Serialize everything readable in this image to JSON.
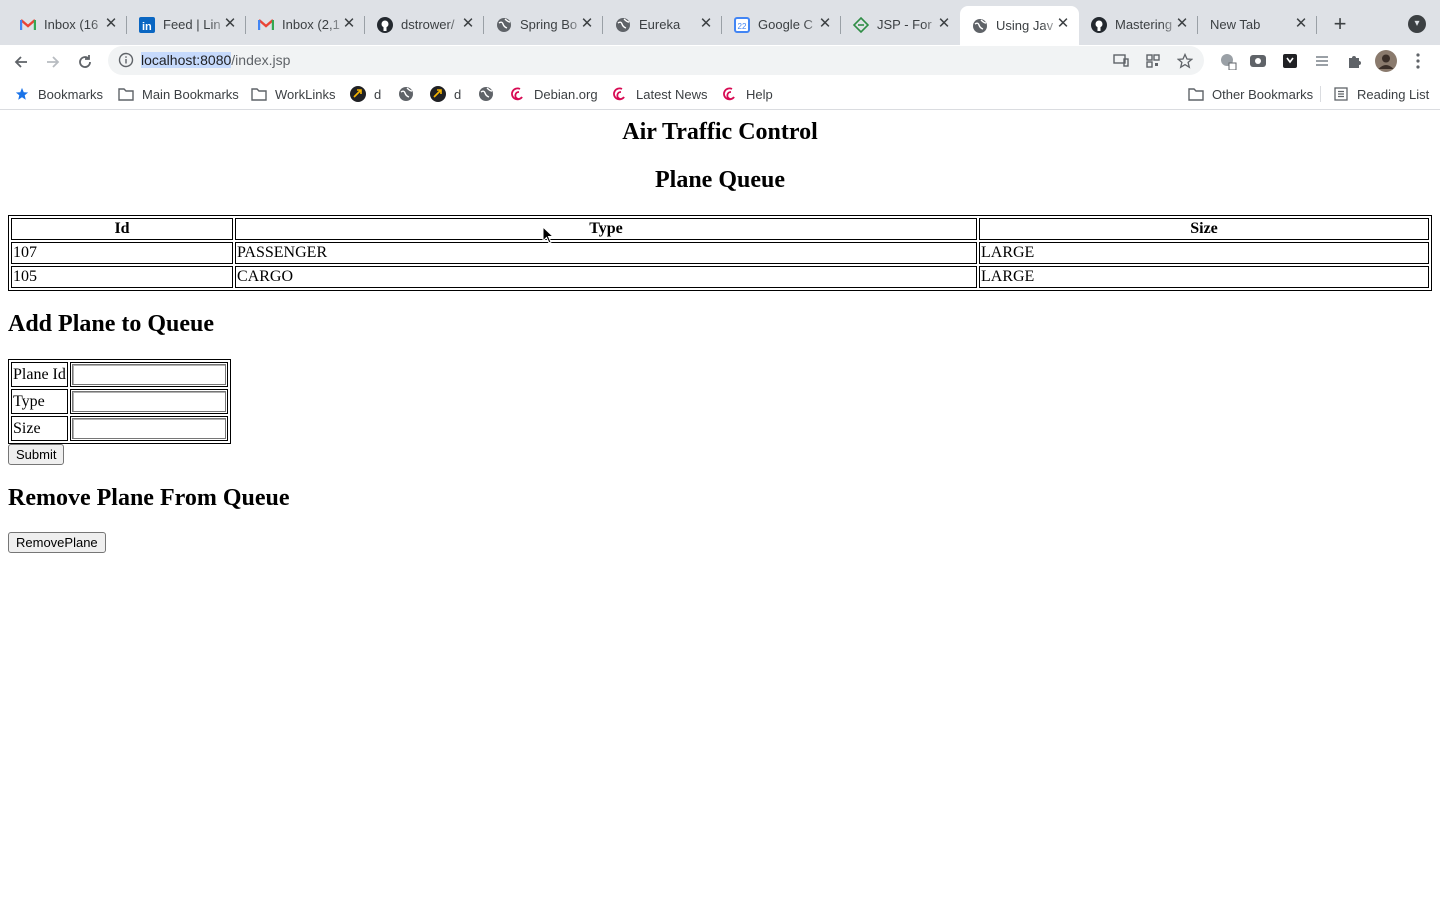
{
  "browser": {
    "tabs": [
      {
        "title": "Inbox (16",
        "icon": "gmail-icon"
      },
      {
        "title": "Feed | Lin",
        "icon": "linkedin-icon"
      },
      {
        "title": "Inbox (2,1",
        "icon": "gmail-icon"
      },
      {
        "title": "dstrower/",
        "icon": "github-icon"
      },
      {
        "title": "Spring Bo",
        "icon": "globe-icon"
      },
      {
        "title": "Eureka",
        "icon": "globe-icon"
      },
      {
        "title": "Google C",
        "icon": "google-calendar-icon"
      },
      {
        "title": "JSP - For",
        "icon": "diamond-icon"
      },
      {
        "title": "Using Jav",
        "icon": "globe-icon"
      },
      {
        "title": "Mastering",
        "icon": "github-icon"
      },
      {
        "title": "New Tab",
        "icon": ""
      }
    ],
    "active_tab_index": 8,
    "url_host": "localhost:8080",
    "url_path": "/index.jsp",
    "bookmarks": [
      {
        "label": "Bookmarks",
        "icon": "star-icon"
      },
      {
        "label": "Main Bookmarks",
        "icon": "folder-icon"
      },
      {
        "label": "WorkLinks",
        "icon": "folder-icon"
      },
      {
        "label": "d",
        "icon": "site-icon"
      },
      {
        "label": "",
        "icon": "globe-icon"
      },
      {
        "label": "d",
        "icon": "site-icon"
      },
      {
        "label": "",
        "icon": "globe-icon"
      },
      {
        "label": "Debian.org",
        "icon": "debian-icon"
      },
      {
        "label": "Latest News",
        "icon": "debian-icon"
      },
      {
        "label": "Help",
        "icon": "debian-icon"
      }
    ],
    "other_bookmarks": "Other Bookmarks",
    "reading_list": "Reading List"
  },
  "page": {
    "title": "Air Traffic Control",
    "queue_heading": "Plane Queue",
    "queue_columns": [
      "Id",
      "Type",
      "Size"
    ],
    "queue_rows": [
      [
        "107",
        "PASSENGER",
        "LARGE"
      ],
      [
        "105",
        "CARGO",
        "LARGE"
      ]
    ],
    "add_heading": "Add Plane to Queue",
    "form_fields": [
      {
        "label": "Plane Id",
        "value": ""
      },
      {
        "label": "Type",
        "value": ""
      },
      {
        "label": "Size",
        "value": ""
      }
    ],
    "submit_label": "Submit",
    "remove_heading": "Remove Plane From Queue",
    "remove_label": "RemovePlane"
  },
  "colors": {
    "tabstrip": "#dee1e6",
    "omnibox": "#f1f3f4",
    "url_highlight": "#c6dafc"
  }
}
